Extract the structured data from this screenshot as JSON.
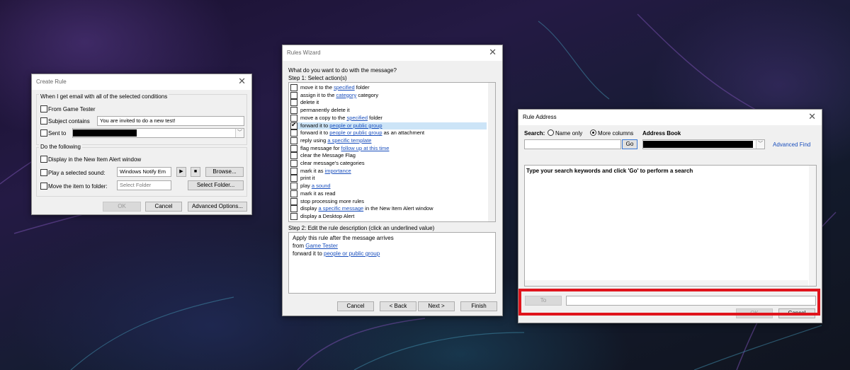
{
  "create_rule": {
    "title": "Create Rule",
    "close": "✕",
    "conditions_header": "When I get email with all of the selected conditions",
    "from_label": "From Game Tester",
    "subject_label": "Subject contains",
    "subject_value": "You are invited to do a new test!",
    "sent_to_label": "Sent to",
    "do_following_header": "Do the following",
    "display_alert_label": "Display in the New Item Alert window",
    "play_sound_label": "Play a selected sound:",
    "sound_value": "Windows Notify Em",
    "play_glyph": "▶",
    "stop_glyph": "■",
    "browse_label": "Browse...",
    "move_label": "Move the item to folder:",
    "folder_value": "Select Folder",
    "select_folder_label": "Select Folder...",
    "ok_label": "OK",
    "cancel_label": "Cancel",
    "advanced_label": "Advanced Options..."
  },
  "rules_wizard": {
    "title": "Rules Wizard",
    "close": "✕",
    "question": "What do you want to do with the message?",
    "step1": "Step 1: Select action(s)",
    "actions": [
      {
        "pre": "move it to the ",
        "link": "specified",
        "post": " folder",
        "checked": false
      },
      {
        "pre": "assign it to the ",
        "link": "category",
        "post": " category",
        "checked": false
      },
      {
        "pre": "delete it",
        "link": "",
        "post": "",
        "checked": false
      },
      {
        "pre": "permanently delete it",
        "link": "",
        "post": "",
        "checked": false
      },
      {
        "pre": "move a copy to the ",
        "link": "specified",
        "post": " folder",
        "checked": false
      },
      {
        "pre": "forward it to ",
        "link": "people or public group",
        "post": "",
        "checked": true
      },
      {
        "pre": "forward it to ",
        "link": "people or public group",
        "post": " as an attachment",
        "checked": false
      },
      {
        "pre": "reply using ",
        "link": "a specific template",
        "post": "",
        "checked": false
      },
      {
        "pre": "flag message for ",
        "link": "follow up at this time",
        "post": "",
        "checked": false
      },
      {
        "pre": "clear the Message Flag",
        "link": "",
        "post": "",
        "checked": false
      },
      {
        "pre": "clear message's categories",
        "link": "",
        "post": "",
        "checked": false
      },
      {
        "pre": "mark it as ",
        "link": "importance",
        "post": "",
        "checked": false
      },
      {
        "pre": "print it",
        "link": "",
        "post": "",
        "checked": false
      },
      {
        "pre": "play ",
        "link": "a sound",
        "post": "",
        "checked": false
      },
      {
        "pre": "mark it as read",
        "link": "",
        "post": "",
        "checked": false
      },
      {
        "pre": "stop processing more rules",
        "link": "",
        "post": "",
        "checked": false
      },
      {
        "pre": "display ",
        "link": "a specific message",
        "post": " in the New Item Alert window",
        "checked": false
      },
      {
        "pre": "display a Desktop Alert",
        "link": "",
        "post": "",
        "checked": false
      }
    ],
    "step2": "Step 2: Edit the rule description (click an underlined value)",
    "desc_line1": "Apply this rule after the message arrives",
    "desc_from_pre": "from ",
    "desc_from_link": "Game Tester",
    "desc_fwd_pre": "forward it to ",
    "desc_fwd_link": "people or public group",
    "cancel_label": "Cancel",
    "back_label": "< Back",
    "next_label": "Next >",
    "finish_label": "Finish"
  },
  "rule_address": {
    "title": "Rule Address",
    "close": "✕",
    "search_label": "Search:",
    "name_only_label": "Name only",
    "more_columns_label": "More columns",
    "address_book_label": "Address Book",
    "go_label": "Go",
    "advanced_find_label": "Advanced Find",
    "results_hint": "Type your search keywords and click 'Go' to perform a search",
    "to_label": "To",
    "ok_label": "OK",
    "cancel_label": "Cancel",
    "highlight_color": "#e0141c"
  }
}
